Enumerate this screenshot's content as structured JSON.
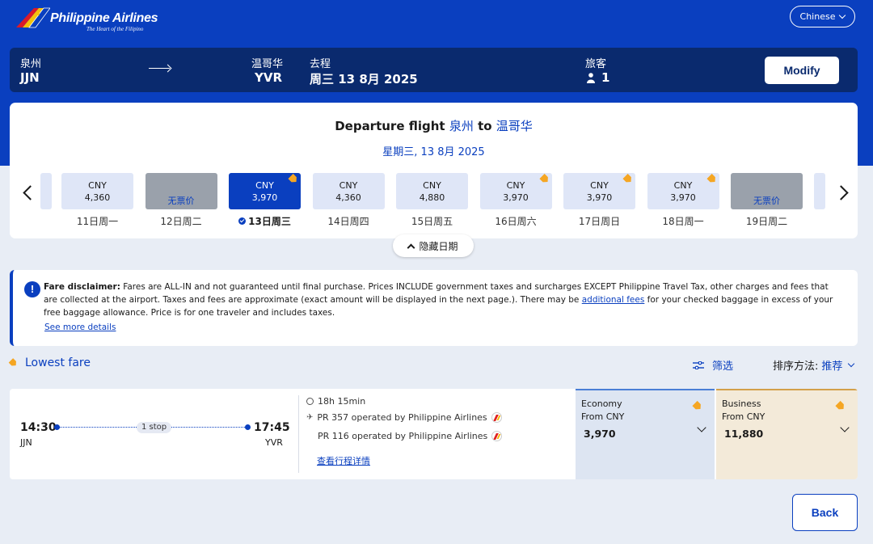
{
  "brand": {
    "name": "Philippine Airlines",
    "tagline": "The Heart of the Filipino"
  },
  "language": {
    "label": "Chinese"
  },
  "summary": {
    "origin_city": "泉州",
    "origin_code": "JJN",
    "dest_city": "温哥华",
    "dest_code": "YVR",
    "trip_label": "去程",
    "trip_date": "周三 13 8月 2025",
    "passengers_label": "旅客",
    "passengers_count": "1",
    "modify_label": "Modify"
  },
  "departure": {
    "title_prefix": "Departure flight",
    "from_city": "泉州",
    "to_word": "to",
    "to_city": "温哥华",
    "date": "星期三, 13 8月 2025"
  },
  "dates": [
    {
      "currency": "CNY",
      "amount": "4,360",
      "label": "11日周一",
      "status": "normal",
      "tag": false
    },
    {
      "currency": "",
      "amount": "",
      "label": "12日周二",
      "status": "sold",
      "no_fare": "无票价",
      "tag": false
    },
    {
      "currency": "CNY",
      "amount": "3,970",
      "label": "13日周三",
      "status": "selected",
      "tag": true
    },
    {
      "currency": "CNY",
      "amount": "4,360",
      "label": "14日周四",
      "status": "normal",
      "tag": false
    },
    {
      "currency": "CNY",
      "amount": "4,880",
      "label": "15日周五",
      "status": "normal",
      "tag": false
    },
    {
      "currency": "CNY",
      "amount": "3,970",
      "label": "16日周六",
      "status": "normal",
      "tag": true
    },
    {
      "currency": "CNY",
      "amount": "3,970",
      "label": "17日周日",
      "status": "normal",
      "tag": true
    },
    {
      "currency": "CNY",
      "amount": "3,970",
      "label": "18日周一",
      "status": "normal",
      "tag": true
    },
    {
      "currency": "",
      "amount": "",
      "label": "19日周二",
      "status": "sold",
      "no_fare": "无票价",
      "tag": false
    }
  ],
  "hide_dates_label": "隐藏日期",
  "disclaimer": {
    "heading": "Fare disclaimer:",
    "text1": " Fares are ALL-IN and not guaranteed until final purchase. Prices INCLUDE government taxes and surcharges EXCEPT Philippine Travel Tax, other charges and fees that are collected at the airport. Taxes and fees are approximate (exact amount will be displayed in the next page.). There may be ",
    "link": "additional fees",
    "text2": " for your checked baggage in excess of your free baggage allowance. Price is for one traveler and includes taxes.",
    "see_more": "See more details"
  },
  "results_bar": {
    "lowest_fare": "Lowest fare",
    "filter": "筛选",
    "sort_label": "排序方法:",
    "sort_value": "推荐"
  },
  "flight": {
    "dep_time": "14:30",
    "dep_code": "JJN",
    "arr_time": "17:45",
    "arr_code": "YVR",
    "stops": "1 stop",
    "duration": "18h 15min",
    "segment1": "PR 357 operated by Philippine Airlines",
    "segment2": "PR 116 operated by Philippine Airlines",
    "itinerary_link": "查看行程详情",
    "economy": {
      "name": "Economy",
      "from": "From  CNY",
      "amount": "3,970"
    },
    "business": {
      "name": "Business",
      "from": "From  CNY",
      "amount": "11,880"
    }
  },
  "back_label": "Back",
  "colors": {
    "brand_blue": "#0a3fbf",
    "navy": "#0a2a6e",
    "tag_orange": "#f5a623"
  }
}
